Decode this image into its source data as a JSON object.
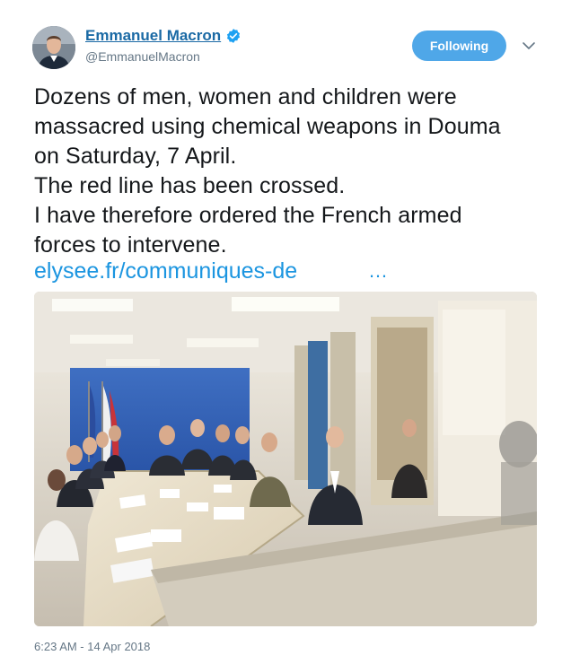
{
  "author": {
    "display_name": "Emmanuel Macron",
    "handle": "@EmmanuelMacron",
    "verified": true,
    "avatar_icon": "profile-photo"
  },
  "follow_button": {
    "label": "Following",
    "color": "#4fa7e8"
  },
  "menu": {
    "icon": "chevron-down-icon"
  },
  "tweet": {
    "lines": [
      "Dozens of men, women and children were",
      "massacred using chemical weapons in Douma",
      "on Saturday, 7 April.",
      "The red line has been crossed.",
      "I have therefore ordered the French armed",
      "forces to intervene."
    ],
    "link_text": "elysee.fr/communiques-de",
    "link_ellipsis": "…",
    "link_color": "#1b95e0"
  },
  "media": {
    "type": "photo"
  },
  "timestamp": "6:23 AM - 14 Apr 2018"
}
